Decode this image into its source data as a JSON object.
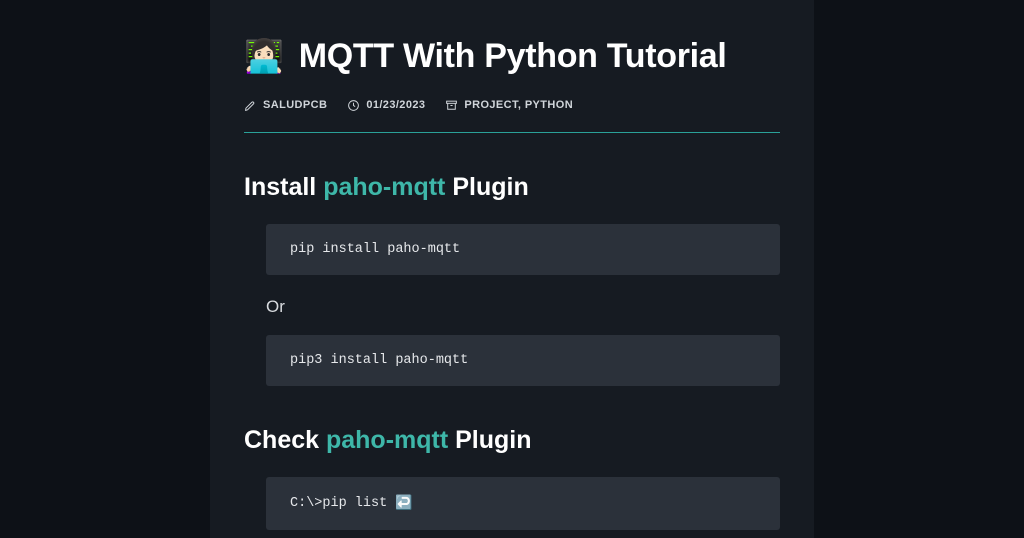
{
  "page": {
    "title_emoji": "👩🏻‍💻",
    "title": "MQTT With Python Tutorial"
  },
  "meta": {
    "author": "SALUDPCB",
    "date": "01/23/2023",
    "categories": "PROJECT, PYTHON"
  },
  "sections": {
    "install": {
      "heading_pre": "Install ",
      "heading_hl": "paho-mqtt",
      "heading_post": " Plugin",
      "code1": "pip install paho-mqtt",
      "or": "Or",
      "code2": "pip3 install paho-mqtt"
    },
    "check": {
      "heading_pre": "Check ",
      "heading_hl": "paho-mqtt",
      "heading_post": " Plugin",
      "code1_a": "C:\\>pip list ",
      "code1_b": "↩️"
    }
  }
}
